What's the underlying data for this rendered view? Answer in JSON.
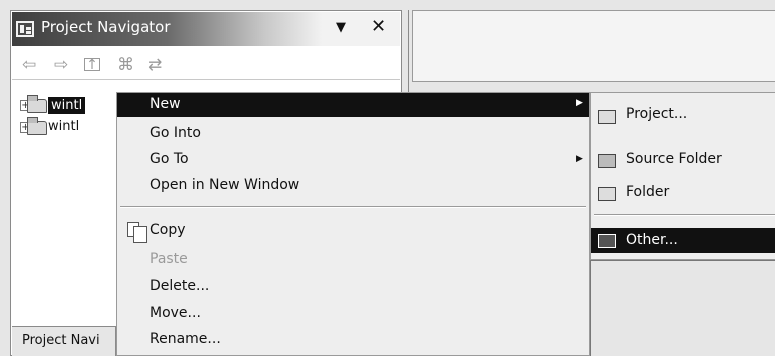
{
  "navigator": {
    "title": "Project Navigator",
    "menu_glyph": "▼",
    "close_glyph": "✕",
    "toolbar": [
      "back-icon",
      "forward-icon",
      "up-icon",
      "collapse-all-icon",
      "link-editor-icon"
    ],
    "tree": [
      {
        "label": "wintl",
        "selected": true
      },
      {
        "label": "wintl",
        "selected": false
      }
    ],
    "bottom_tab": "Project Navi"
  },
  "context_menu": {
    "items": [
      {
        "label": "New",
        "highlighted": true,
        "submenu": true
      },
      {
        "label": "Go Into"
      },
      {
        "label": "Go To",
        "submenu": true
      },
      {
        "label": "Open in New Window"
      },
      {
        "label": "Copy",
        "icon": "copy-icon"
      },
      {
        "label": "Paste",
        "disabled": true
      },
      {
        "label": "Delete..."
      },
      {
        "label": "Move..."
      },
      {
        "label": "Rename..."
      }
    ]
  },
  "submenu_new": {
    "items": [
      {
        "label": "Project...",
        "icon": "project-icon"
      },
      {
        "label": "Source Folder",
        "icon": "source-folder-icon"
      },
      {
        "label": "Folder",
        "icon": "folder-icon"
      },
      {
        "label": "Other...",
        "icon": "other-icon",
        "highlighted": true
      }
    ]
  }
}
